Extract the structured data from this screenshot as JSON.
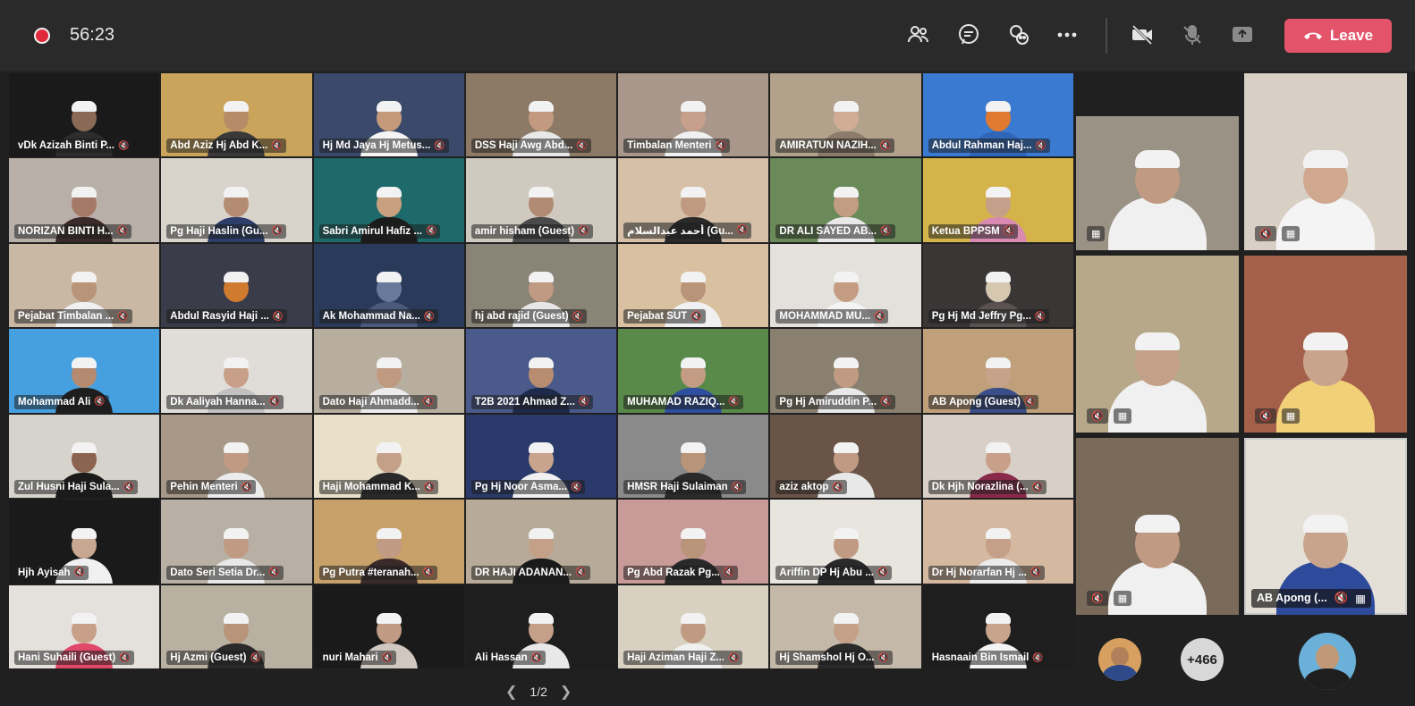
{
  "meeting": {
    "timer": "56:23",
    "leave_label": "Leave",
    "page_indicator": "1/2",
    "overflow_count": "+466"
  },
  "toolbar": {
    "icons": [
      "people-icon",
      "chat-icon",
      "reactions-icon",
      "more-icon",
      "camera-off-icon",
      "mic-off-icon",
      "share-icon"
    ]
  },
  "participants": [
    {
      "name": "vDk Azizah Binti P...",
      "bg": "#1a1a1a",
      "skin": "#8a6a56",
      "cloth": "#2d2d2d"
    },
    {
      "name": "Abd Aziz Hj Abd K...",
      "bg": "#c9a45a",
      "skin": "#b78a68",
      "cloth": "#3a3a3a"
    },
    {
      "name": "Hj Md Jaya Hj Metus...",
      "bg": "#3b4a6a",
      "skin": "#c49a7a",
      "cloth": "#f4f4f4"
    },
    {
      "name": "DSS Haji Awg Abd...",
      "bg": "#8c7a66",
      "skin": "#c19a80",
      "cloth": "#e8e8e8"
    },
    {
      "name": "Timbalan Menteri",
      "bg": "#a8978a",
      "skin": "#c6a08a",
      "cloth": "#f0f0f0"
    },
    {
      "name": "AMIRATUN NAZIH...",
      "bg": "#b2a28c",
      "skin": "#d0ad94",
      "cloth": "#8c7a6a"
    },
    {
      "name": "Abdul Rahman Haj...",
      "bg": "#3a7ad0",
      "skin": "#e07a30",
      "cloth": "#2f66b8"
    },
    {
      "name": "NORIZAN BINTI H...",
      "bg": "#b8b0a8",
      "skin": "#a47a66",
      "cloth": "#3a2a2a"
    },
    {
      "name": "Pg Haji Haslin (Gu...",
      "bg": "#d8d4cc",
      "skin": "#b48c74",
      "cloth": "#2e3e6a"
    },
    {
      "name": "Sabri Amirul Hafiz ...",
      "bg": "#1e6a6a",
      "skin": "#c8a080",
      "cloth": "#1b1b1b"
    },
    {
      "name": "amir hisham (Guest)",
      "bg": "#cfc9bf",
      "skin": "#b08a72",
      "cloth": "#4a4a4a"
    },
    {
      "name": "أحمد عبدالسلام (Gu...",
      "bg": "#d6c0a8",
      "skin": "#c09a80",
      "cloth": "#2a2a2a"
    },
    {
      "name": "DR ALI SAYED AB...",
      "bg": "#6a8a5a",
      "skin": "#c39c84",
      "cloth": "#e8e8e8"
    },
    {
      "name": "Ketua BPPSM",
      "bg": "#d4b44a",
      "skin": "#c4a08a",
      "cloth": "#d88ab0"
    },
    {
      "name": "Pejabat Timbalan ...",
      "bg": "#c8b8a4",
      "skin": "#b89478",
      "cloth": "#f0f0f0"
    },
    {
      "name": "Abdul Rasyid Haji ...",
      "bg": "#3a3c4a",
      "skin": "#d07a30",
      "cloth": "#3a3c4a"
    },
    {
      "name": "Ak Mohammad Na...",
      "bg": "#2a3a5a",
      "skin": "#6a7a9a",
      "cloth": "#4a5a7a"
    },
    {
      "name": "hj abd rajid (Guest)",
      "bg": "#8a8476",
      "skin": "#c09a82",
      "cloth": "#e6e6e6"
    },
    {
      "name": "Pejabat SUT",
      "bg": "#d8c0a0",
      "skin": "#b89478",
      "cloth": "#f0f0f0"
    },
    {
      "name": "MOHAMMAD MU...",
      "bg": "#e4e0dc",
      "skin": "#c49c82",
      "cloth": "#f4f4f4"
    },
    {
      "name": "Pg Hj Md Jeffry Pg...",
      "bg": "#3a3636",
      "skin": "#d6c8b0",
      "cloth": "#5a5252"
    },
    {
      "name": "Mohammad Ali",
      "bg": "#46a0e0",
      "skin": "#b48a70",
      "cloth": "#1e1e1e"
    },
    {
      "name": "Dk Aaliyah Hanna...",
      "bg": "#e0dcd8",
      "skin": "#c8a08a",
      "cloth": "#c4c0c0"
    },
    {
      "name": "Dato Haji Ahmadd...",
      "bg": "#b8aea0",
      "skin": "#c09a80",
      "cloth": "#ececec"
    },
    {
      "name": "T2B 2021 Ahmad Z...",
      "bg": "#4a5a8a",
      "skin": "#b88c70",
      "cloth": "#1e2a4a"
    },
    {
      "name": "MUHAMAD RAZIQ...",
      "bg": "#5a8a4a",
      "skin": "#c49c84",
      "cloth": "#2e4ea0"
    },
    {
      "name": "Pg Hj Amiruddin P...",
      "bg": "#8a8070",
      "skin": "#c09a82",
      "cloth": "#e8e8e8"
    },
    {
      "name": "AB Apong (Guest)",
      "bg": "#c0a07a",
      "skin": "#c6a28a",
      "cloth": "#3a4e8a"
    },
    {
      "name": "Zul Husni Haji Sula...",
      "bg": "#d6d2cc",
      "skin": "#8a644e",
      "cloth": "#1a1a1a"
    },
    {
      "name": "Pehin Menteri",
      "bg": "#a89888",
      "skin": "#c09a82",
      "cloth": "#ececec"
    },
    {
      "name": "Haji Mohammad K...",
      "bg": "#e8e0c8",
      "skin": "#c4a088",
      "cloth": "#2a2a2a"
    },
    {
      "name": "Pg Hj Noor Asma...",
      "bg": "#2a3a6a",
      "skin": "#c8a48c",
      "cloth": "#f0f0f0"
    },
    {
      "name": "HMSR Haji Sulaiman",
      "bg": "#8a8a8a",
      "skin": "#b89478",
      "cloth": "#2a2a2a"
    },
    {
      "name": "aziz aktop",
      "bg": "#6a5448",
      "skin": "#c09a82",
      "cloth": "#e8e8e8"
    },
    {
      "name": "Dk Hjh Norazlina (...",
      "bg": "#d8d0c8",
      "skin": "#c8a08a",
      "cloth": "#8a2a4a"
    },
    {
      "name": "Hjh Ayisah",
      "bg": "#1a1a1a",
      "skin": "#c8a890",
      "cloth": "#f0f0f0"
    },
    {
      "name": "Dato Seri Setia Dr...",
      "bg": "#b8b0a4",
      "skin": "#c09a82",
      "cloth": "#e8e8e8"
    },
    {
      "name": "Pg Putra #teranah...",
      "bg": "#c8a06a",
      "skin": "#c09a82",
      "cloth": "#3a2a2a"
    },
    {
      "name": "DR HAJI ADANAN...",
      "bg": "#b8aa98",
      "skin": "#c4a088",
      "cloth": "#1a1a1a"
    },
    {
      "name": "Pg Abd Razak Pg...",
      "bg": "#c89a98",
      "skin": "#b89478",
      "cloth": "#2a2a2a"
    },
    {
      "name": "Ariffin DP Hj Abu ...",
      "bg": "#e8e4de",
      "skin": "#c09a82",
      "cloth": "#2a2a2a"
    },
    {
      "name": "Dr Hj Norarfan Hj ...",
      "bg": "#d4b8a0",
      "skin": "#c4a088",
      "cloth": "#ececec"
    },
    {
      "name": "Hani Suhaili (Guest)",
      "bg": "#e4e0dc",
      "skin": "#c8a08a",
      "cloth": "#e0486a"
    },
    {
      "name": "Hj Azmi (Guest)",
      "bg": "#b8b0a0",
      "skin": "#b89478",
      "cloth": "#2a2a2a"
    },
    {
      "name": "nuri Mahari",
      "bg": "#1a1a1a",
      "skin": "#c09a82",
      "cloth": "#d0c8c0"
    },
    {
      "name": "Ali Hassan",
      "bg": "#1e1e1e",
      "skin": "#c4a088",
      "cloth": "#e8e8e8"
    },
    {
      "name": "Haji Aziman Haji Z...",
      "bg": "#d8d0c0",
      "skin": "#c09a82",
      "cloth": "#f0f0f0"
    },
    {
      "name": "Hj Shamshol Hj O...",
      "bg": "#c4b8a8",
      "skin": "#c4a088",
      "cloth": "#2a2a2a"
    },
    {
      "name": "Hasnaain Bin Ismail",
      "bg": "#1e1e1e",
      "skin": "#c8a48c",
      "cloth": "#f4f4f4"
    }
  ],
  "side_tiles": [
    {
      "bg": "#9a9284",
      "cloth": "#f0f0f0",
      "skin": "#c09a82",
      "badges": [
        "screen-icon"
      ]
    },
    {
      "bg": "#d8d0c4",
      "cloth": "#f4f4f4",
      "skin": "#d0a890",
      "badges": [
        "mic-off-icon",
        "screen-icon"
      ]
    },
    {
      "bg": "#b8a88a",
      "cloth": "#f0f0f0",
      "skin": "#c4a088",
      "badges": [
        "mic-off-icon",
        "screen-icon"
      ]
    },
    {
      "bg": "#a4604a",
      "cloth": "#f2d078",
      "skin": "#c8a48c",
      "badges": [
        "mic-off-icon",
        "screen-icon"
      ]
    },
    {
      "bg": "#7a6a5a",
      "cloth": "#f0f0f0",
      "skin": "#c09a82",
      "badges": [
        "mic-off-icon",
        "screen-icon"
      ]
    },
    {
      "bg": "#e4e0d8",
      "cloth": "#2e4a9a",
      "skin": "#c8a48c",
      "name": "AB Apong (...",
      "badges": [
        "mic-off-icon",
        "screen-icon"
      ]
    }
  ],
  "colors": {
    "background": "#202020",
    "toolbar": "#2a2a2a",
    "leave_button": "#e3546a",
    "record_dot": "#e0293b"
  }
}
